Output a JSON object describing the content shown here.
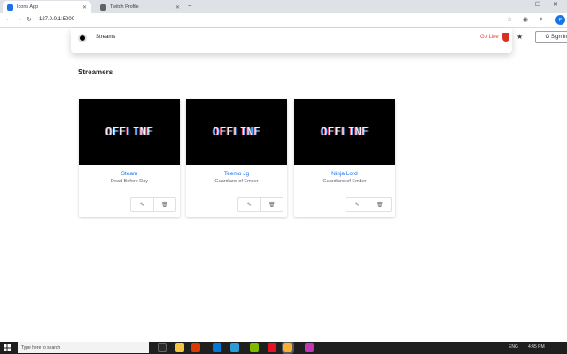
{
  "browser": {
    "tabs": [
      {
        "label": "Icons App",
        "favicon_color": "#1a73e8"
      },
      {
        "label": "Twitch Profile",
        "favicon_color": "#5f6368"
      }
    ],
    "new_tab": "+",
    "url": "127.0.0.1:5000",
    "window": {
      "minimize": "–",
      "maximize": "☐",
      "close": "✕"
    }
  },
  "search": {
    "query": "Streams",
    "live_label": "Go Live",
    "sign_in": "G Sign In"
  },
  "section": {
    "title": "Streamers"
  },
  "streamers": [
    {
      "thumb_text": "OFFLINE",
      "name": "Steam",
      "game": "Dead Before Day"
    },
    {
      "thumb_text": "OFFLINE",
      "name": "Teemo Jg",
      "game": "Guardians of Ember"
    },
    {
      "thumb_text": "OFFLINE",
      "name": "Ninja Lord",
      "game": "Guardians of Ember"
    }
  ],
  "taskbar": {
    "search_placeholder": "Type here to search",
    "time": "4:45 PM",
    "lang": "ENG"
  },
  "icons": {
    "back": "back-arrow-icon",
    "forward": "forward-arrow-icon",
    "reload": "reload-icon",
    "edit": "edit-icon",
    "delete": "delete-icon"
  }
}
